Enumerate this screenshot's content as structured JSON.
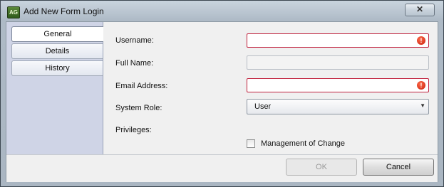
{
  "window": {
    "title": "Add New Form Login",
    "icon_text": "AG",
    "close_glyph": "✕"
  },
  "sidebar": {
    "tabs": [
      {
        "label": "General",
        "active": true
      },
      {
        "label": "Details",
        "active": false
      },
      {
        "label": "History",
        "active": false
      }
    ]
  },
  "form": {
    "username": {
      "label": "Username:",
      "value": "",
      "error": true
    },
    "full_name": {
      "label": "Full Name:",
      "value": "",
      "disabled": true
    },
    "email": {
      "label": "Email Address:",
      "value": "",
      "error": true
    },
    "system_role": {
      "label": "System Role:",
      "selected": "User"
    },
    "privileges": {
      "label": "Privileges:",
      "options": [
        {
          "label": "Management of Change",
          "checked": false
        }
      ]
    },
    "error_glyph": "!"
  },
  "footer": {
    "ok_label": "OK",
    "cancel_label": "Cancel"
  },
  "colors": {
    "error_border": "#c0203c",
    "sidebar_bg": "#cfd4e6"
  },
  "icons": {
    "close": "close-icon",
    "error": "error-icon",
    "dropdown": "chevron-down-icon"
  }
}
